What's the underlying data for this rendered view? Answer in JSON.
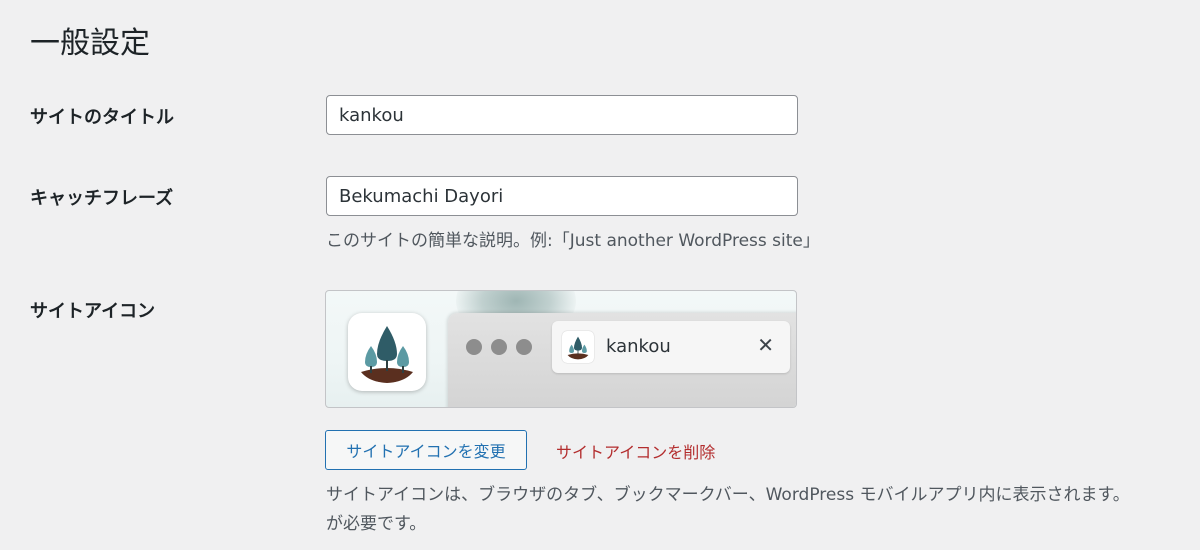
{
  "page": {
    "title": "一般設定"
  },
  "fields": {
    "site_title": {
      "label": "サイトのタイトル",
      "value": "kankou"
    },
    "tagline": {
      "label": "キャッチフレーズ",
      "value": "Bekumachi Dayori",
      "description": "このサイトの簡単な説明。例:「Just another WordPress site」"
    },
    "site_icon": {
      "label": "サイトアイコン",
      "preview_tab_title": "kankou",
      "close_glyph": "✕",
      "change_button": "サイトアイコンを変更",
      "remove_link": "サイトアイコンを削除",
      "description_line1": "サイトアイコンは、ブラウザのタブ、ブックマークバー、WordPress モバイルアプリ内に表示されます。",
      "description_line2": "が必要です。"
    }
  },
  "colors": {
    "background": "#f0f0f1",
    "primary_blue": "#2271b1",
    "danger_red": "#b32d2e",
    "text": "#1d2327",
    "muted_text": "#50575e",
    "tree_teal_dark": "#2f5c67",
    "tree_teal_light": "#5b9aa3",
    "soil_brown": "#5a2f1f"
  },
  "icons": {
    "site_logo": "tree-island-icon",
    "tab_close": "close-icon"
  }
}
